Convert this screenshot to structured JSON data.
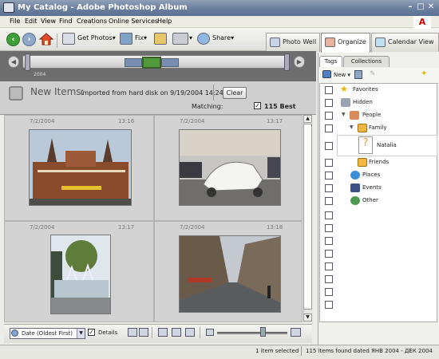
{
  "window": {
    "title": "My Catalog - Adobe Photoshop Album",
    "adobe_logo": "A"
  },
  "menu": [
    "File",
    "Edit",
    "View",
    "Find",
    "Creations",
    "Online Services",
    "Help"
  ],
  "toolbar": {
    "get_photos": "Get Photos",
    "fix": "Fix",
    "share": "Share"
  },
  "tabs": {
    "photo_well": "Photo Well",
    "organize": "Organize",
    "calendar_view": "Calendar View"
  },
  "timeline": {
    "year": "2004"
  },
  "new_items": {
    "title": "New Items:",
    "description": "Imported from hard disk on 9/19/2004 14:24",
    "clear_label": "Clear",
    "matching_label": "Matching:",
    "matching_value": "115 Best",
    "matching_checked": "✓"
  },
  "photos": [
    {
      "date": "7/2/2004",
      "time": "13:16"
    },
    {
      "date": "7/2/2004",
      "time": "13:17"
    },
    {
      "date": "7/2/2004",
      "time": "13:17"
    },
    {
      "date": "7/2/2004",
      "time": "13:18"
    }
  ],
  "bottom": {
    "sort": "Date (Oldest First)",
    "details_label": "Details",
    "details_checked": "✓"
  },
  "status": {
    "selected": "1 item selected",
    "found": "115 items found dated ЯНВ 2004 - ДЕК 2004"
  },
  "tag_panel": {
    "tabs": {
      "tags": "Tags",
      "collections": "Collections"
    },
    "new_label": "New",
    "tags": {
      "favorites": "Favorites",
      "hidden": "Hidden",
      "people": "People",
      "family": "Family",
      "natalia": "Natalia",
      "friends": "Friends",
      "places": "Places",
      "events": "Events",
      "other": "Other"
    }
  }
}
